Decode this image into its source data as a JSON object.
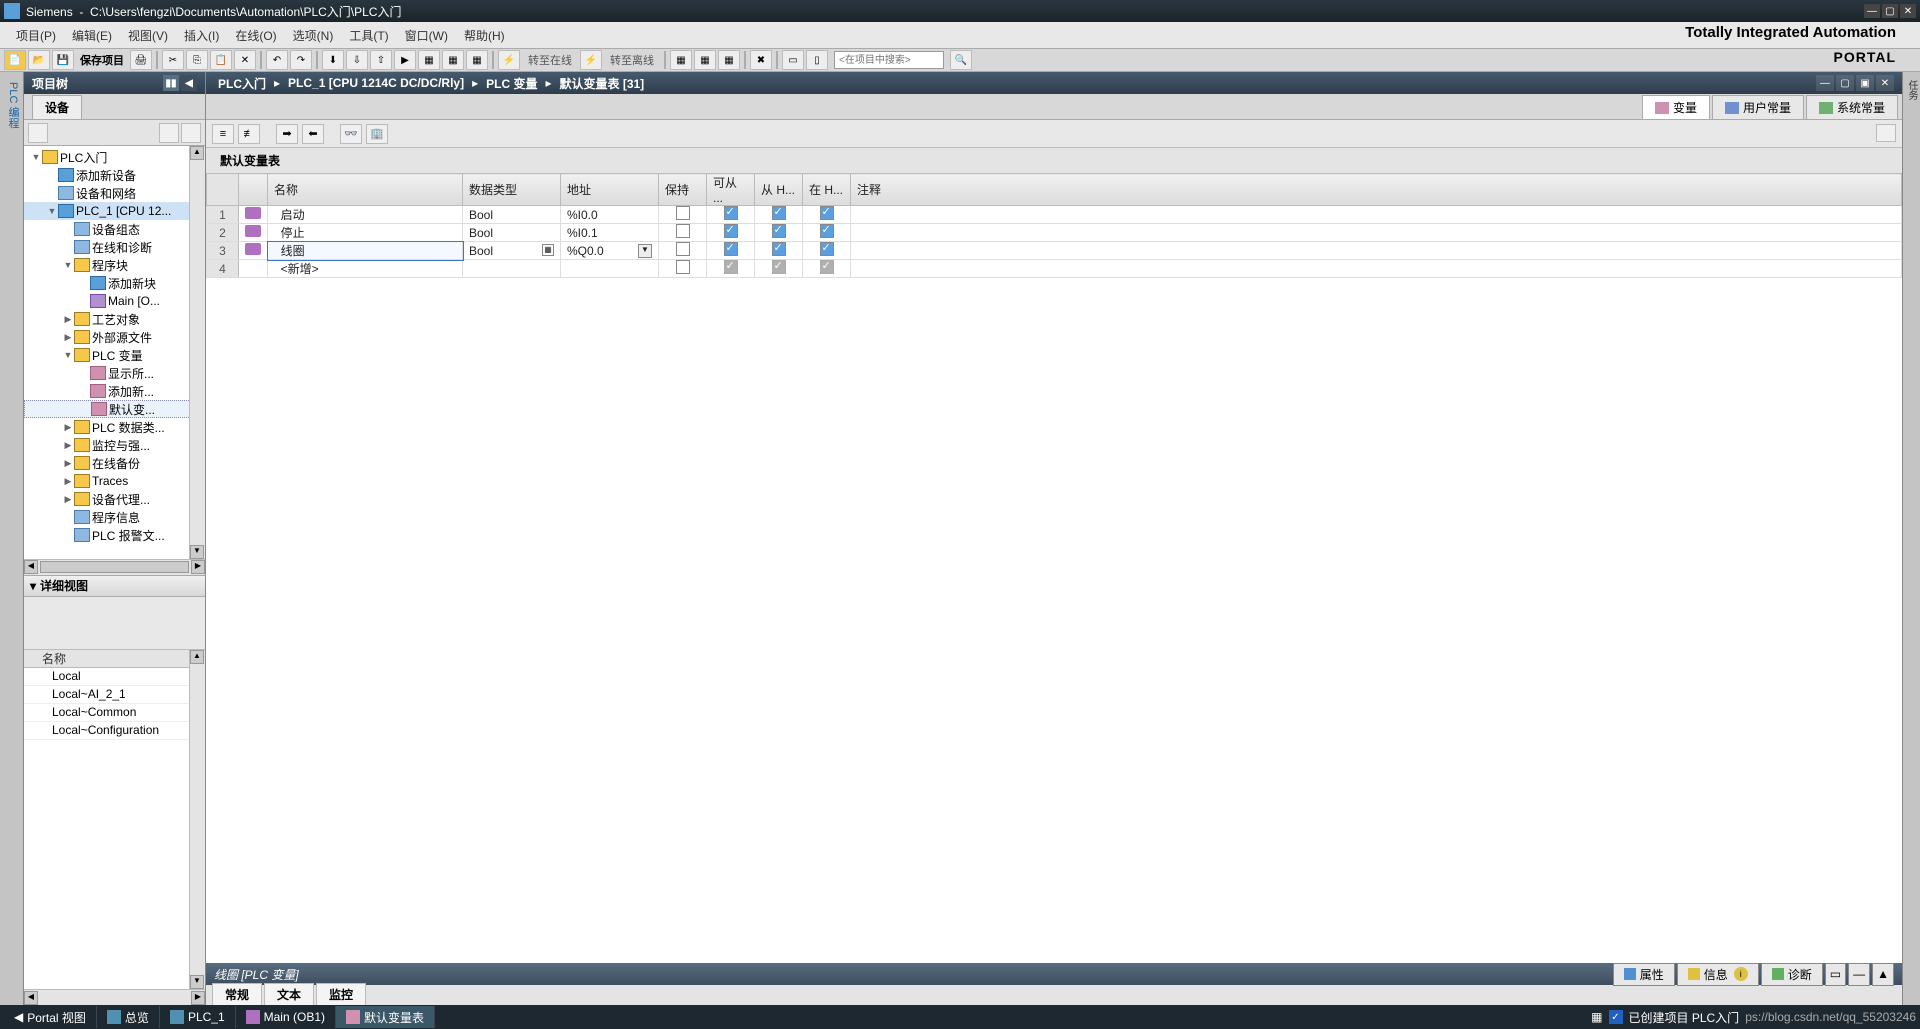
{
  "title_bar": {
    "app": "Siemens",
    "path": "C:\\Users\\fengzi\\Documents\\Automation\\PLC入门\\PLC入门"
  },
  "menu": {
    "project": "项目(P)",
    "edit": "编辑(E)",
    "view": "视图(V)",
    "insert": "插入(I)",
    "online": "在线(O)",
    "options": "选项(N)",
    "tools": "工具(T)",
    "window": "窗口(W)",
    "help": "帮助(H)"
  },
  "branding": {
    "line1": "Totally Integrated Automation",
    "line2": "PORTAL"
  },
  "toolbar": {
    "save": "保存项目",
    "go_online": "转至在线",
    "go_offline": "转至离线",
    "search_placeholder": "<在项目中搜索>"
  },
  "project_tree": {
    "header": "项目树",
    "devices_tab": "设备",
    "nodes": [
      {
        "l": 0,
        "exp": "▼",
        "icon": "fi-folder",
        "label": "PLC入门"
      },
      {
        "l": 1,
        "exp": "",
        "icon": "fi-device",
        "label": "添加新设备"
      },
      {
        "l": 1,
        "exp": "",
        "icon": "fi-blue",
        "label": "设备和网络"
      },
      {
        "l": 1,
        "exp": "▼",
        "icon": "fi-device",
        "label": "PLC_1 [CPU 12...",
        "sel": true
      },
      {
        "l": 2,
        "exp": "",
        "icon": "fi-blue",
        "label": "设备组态"
      },
      {
        "l": 2,
        "exp": "",
        "icon": "fi-blue",
        "label": "在线和诊断"
      },
      {
        "l": 2,
        "exp": "▼",
        "icon": "fi-folder",
        "label": "程序块"
      },
      {
        "l": 3,
        "exp": "",
        "icon": "fi-device",
        "label": "添加新块"
      },
      {
        "l": 3,
        "exp": "",
        "icon": "fi-purple",
        "label": "Main [O..."
      },
      {
        "l": 2,
        "exp": "▶",
        "icon": "fi-folder",
        "label": "工艺对象"
      },
      {
        "l": 2,
        "exp": "▶",
        "icon": "fi-folder",
        "label": "外部源文件"
      },
      {
        "l": 2,
        "exp": "▼",
        "icon": "fi-folder",
        "label": "PLC 变量"
      },
      {
        "l": 3,
        "exp": "",
        "icon": "fi-tag",
        "label": "显示所..."
      },
      {
        "l": 3,
        "exp": "",
        "icon": "fi-tag",
        "label": "添加新..."
      },
      {
        "l": 3,
        "exp": "",
        "icon": "fi-tag",
        "label": "默认变...",
        "hl": true
      },
      {
        "l": 2,
        "exp": "▶",
        "icon": "fi-folder",
        "label": "PLC 数据类..."
      },
      {
        "l": 2,
        "exp": "▶",
        "icon": "fi-folder",
        "label": "监控与强..."
      },
      {
        "l": 2,
        "exp": "▶",
        "icon": "fi-folder",
        "label": "在线备份"
      },
      {
        "l": 2,
        "exp": "▶",
        "icon": "fi-folder",
        "label": "Traces"
      },
      {
        "l": 2,
        "exp": "▶",
        "icon": "fi-folder",
        "label": "设备代理..."
      },
      {
        "l": 2,
        "exp": "",
        "icon": "fi-blue",
        "label": "程序信息"
      },
      {
        "l": 2,
        "exp": "",
        "icon": "fi-blue",
        "label": "PLC 报警文..."
      }
    ]
  },
  "detail_view": {
    "header": "详细视图",
    "name_col": "名称",
    "rows": [
      "Local",
      "Local~AI_2_1",
      "Local~Common",
      "Local~Configuration"
    ]
  },
  "breadcrumb": {
    "p1": "PLC入门",
    "p2": "PLC_1 [CPU 1214C DC/DC/Rly]",
    "p3": "PLC 变量",
    "p4": "默认变量表 [31]"
  },
  "editor_tabs": {
    "vars": "变量",
    "user_const": "用户常量",
    "sys_const": "系统常量"
  },
  "variable_table": {
    "title": "默认变量表",
    "headers": {
      "name": "名称",
      "type": "数据类型",
      "addr": "地址",
      "retain": "保持",
      "acc_hmi": "可从 ...",
      "wri_hmi": "从 H...",
      "vis_hmi": "在 H...",
      "comment": "注释"
    },
    "rows": [
      {
        "n": "1",
        "name": "启动",
        "type": "Bool",
        "addr": "%I0.0",
        "retain": false,
        "c1": true,
        "c2": true,
        "c3": true
      },
      {
        "n": "2",
        "name": "停止",
        "type": "Bool",
        "addr": "%I0.1",
        "retain": false,
        "c1": true,
        "c2": true,
        "c3": true
      },
      {
        "n": "3",
        "name": "线圈",
        "type": "Bool",
        "addr": "%Q0.0",
        "retain": false,
        "c1": true,
        "c2": true,
        "c3": true,
        "sel": true
      }
    ],
    "add_label": "<新增>"
  },
  "bottom_panel": {
    "title": "线圈 [PLC 变量]",
    "tabs": {
      "props": "属性",
      "info": "信息",
      "diag": "诊断"
    },
    "subtabs": {
      "general": "常规",
      "text": "文本",
      "monitor": "监控"
    }
  },
  "taskbar": {
    "portal": "Portal 视图",
    "overview": "总览",
    "plc1": "PLC_1",
    "main": "Main (OB1)",
    "deftable": "默认变量表",
    "status": "已创建项目 PLC入门",
    "watermark": "ps://blog.csdn.net/qq_55203246"
  },
  "sidebars": {
    "left": "PLC 编程",
    "right": "任务"
  }
}
